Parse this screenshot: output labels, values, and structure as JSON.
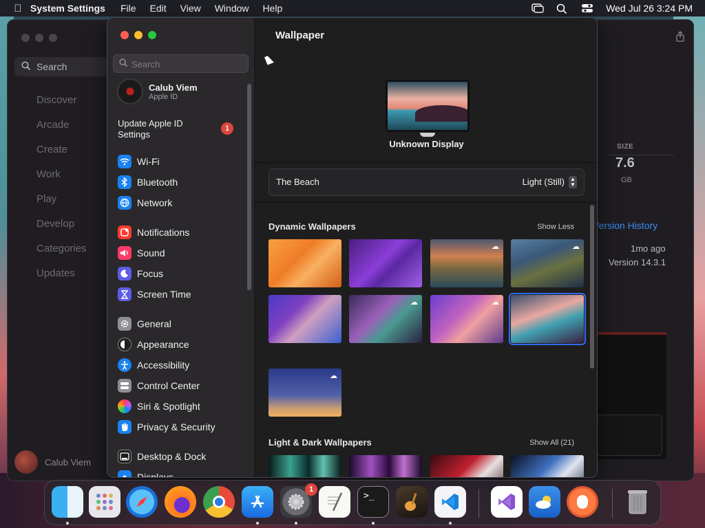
{
  "menubar": {
    "app": "System Settings",
    "menus": [
      "File",
      "Edit",
      "View",
      "Window",
      "Help"
    ],
    "clock": "Wed Jul 26  3:24 PM"
  },
  "background_app": {
    "search_placeholder": "Search",
    "nav": [
      "Discover",
      "Arcade",
      "Create",
      "Work",
      "Play",
      "Develop",
      "Categories",
      "Updates"
    ],
    "user": "Calub Viem",
    "size_label": "SIZE",
    "size_value": "7.6",
    "size_unit": "GB",
    "version_history": "Version History",
    "updated_ago": "1mo ago",
    "version": "Version 14.3.1"
  },
  "sidebar": {
    "search_placeholder": "Search",
    "profile": {
      "name": "Calub Viem",
      "subtitle": "Apple ID"
    },
    "update": {
      "label": "Update Apple ID Settings",
      "badge": "1"
    },
    "items": [
      {
        "label": "Wi-Fi",
        "icon": "wifi-icon",
        "color": "#1a82f0"
      },
      {
        "label": "Bluetooth",
        "icon": "bluetooth-icon",
        "color": "#1a82f0"
      },
      {
        "label": "Network",
        "icon": "globe-icon",
        "color": "#1a82f0"
      },
      {
        "label": "Notifications",
        "icon": "bell-icon",
        "color": "#ff3b30"
      },
      {
        "label": "Sound",
        "icon": "speaker-icon",
        "color": "#ff3a67"
      },
      {
        "label": "Focus",
        "icon": "moon-icon",
        "color": "#5e5ce6"
      },
      {
        "label": "Screen Time",
        "icon": "hourglass-icon",
        "color": "#5e5ce6"
      },
      {
        "label": "General",
        "icon": "gear-icon",
        "color": "#8e8e93"
      },
      {
        "label": "Appearance",
        "icon": "appearance-icon",
        "color": "#1c1c1e"
      },
      {
        "label": "Accessibility",
        "icon": "accessibility-icon",
        "color": "#1a82f0"
      },
      {
        "label": "Control Center",
        "icon": "control-center-icon",
        "color": "#8e8e93"
      },
      {
        "label": "Siri & Spotlight",
        "icon": "siri-icon",
        "color": "rainbow"
      },
      {
        "label": "Privacy & Security",
        "icon": "hand-icon",
        "color": "#1a82f0"
      },
      {
        "label": "Desktop & Dock",
        "icon": "dock-icon",
        "color": "#1c1c1e"
      },
      {
        "label": "Displays",
        "icon": "displays-icon",
        "color": "#1a82f0"
      }
    ]
  },
  "content": {
    "title": "Wallpaper",
    "display_name": "Unknown Display",
    "current_wallpaper": "The Beach",
    "mode": "Light (Still)",
    "sections": [
      {
        "title": "Dynamic Wallpapers",
        "action": "Show Less"
      },
      {
        "title": "Light & Dark Wallpapers",
        "action": "Show All (21)"
      }
    ]
  },
  "dock": {
    "apps": [
      "Finder",
      "Launchpad",
      "Safari",
      "Firefox",
      "Chrome",
      "App Store",
      "System Settings",
      "TextEdit",
      "Terminal",
      "GarageBand",
      "Visual Studio Code",
      "Visual Studio",
      "Weather",
      "DuckDuckGo",
      "Trash"
    ],
    "settings_badge": "1"
  }
}
